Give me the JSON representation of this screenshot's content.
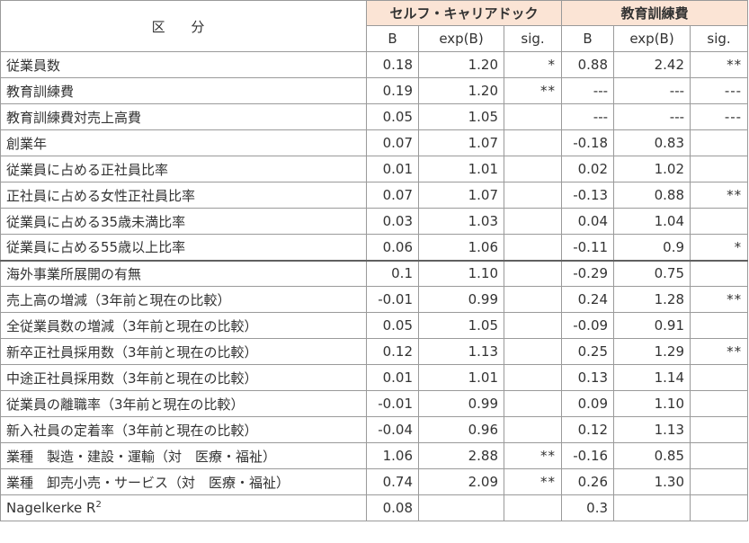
{
  "header": {
    "kubun": "区 分",
    "groups": [
      "セルフ・キャリアドック",
      "教育訓練費"
    ],
    "cols": [
      "B",
      "exp(B)",
      "sig.",
      "B",
      "exp(B)",
      "sig."
    ]
  },
  "rows": [
    {
      "label": "従業員数",
      "s_b": "0.18",
      "s_exp": "1.20",
      "s_sig": "*",
      "e_b": "0.88",
      "e_exp": "2.42",
      "e_sig": "**"
    },
    {
      "label": "教育訓練費",
      "s_b": "0.19",
      "s_exp": "1.20",
      "s_sig": "**",
      "e_b": "---",
      "e_exp": "---",
      "e_sig": "---"
    },
    {
      "label": "教育訓練費対売上高費",
      "s_b": "0.05",
      "s_exp": "1.05",
      "s_sig": "",
      "e_b": "---",
      "e_exp": "---",
      "e_sig": "---"
    },
    {
      "label": "創業年",
      "s_b": "0.07",
      "s_exp": "1.07",
      "s_sig": "",
      "e_b": "-0.18",
      "e_exp": "0.83",
      "e_sig": ""
    },
    {
      "label": "従業員に占める正社員比率",
      "s_b": "0.01",
      "s_exp": "1.01",
      "s_sig": "",
      "e_b": "0.02",
      "e_exp": "1.02",
      "e_sig": ""
    },
    {
      "label": "正社員に占める女性正社員比率",
      "s_b": "0.07",
      "s_exp": "1.07",
      "s_sig": "",
      "e_b": "-0.13",
      "e_exp": "0.88",
      "e_sig": "**"
    },
    {
      "label": "従業員に占める35歳未満比率",
      "s_b": "0.03",
      "s_exp": "1.03",
      "s_sig": "",
      "e_b": "0.04",
      "e_exp": "1.04",
      "e_sig": ""
    },
    {
      "label": "従業員に占める55歳以上比率",
      "s_b": "0.06",
      "s_exp": "1.06",
      "s_sig": "",
      "e_b": "-0.11",
      "e_exp": "0.9",
      "e_sig": "*"
    },
    {
      "label": "海外事業所展開の有無",
      "s_b": "0.1",
      "s_exp": "1.10",
      "s_sig": "",
      "e_b": "-0.29",
      "e_exp": "0.75",
      "e_sig": ""
    },
    {
      "label": "売上高の増減（3年前と現在の比較）",
      "s_b": "-0.01",
      "s_exp": "0.99",
      "s_sig": "",
      "e_b": "0.24",
      "e_exp": "1.28",
      "e_sig": "**"
    },
    {
      "label": "全従業員数の増減（3年前と現在の比較）",
      "s_b": "0.05",
      "s_exp": "1.05",
      "s_sig": "",
      "e_b": "-0.09",
      "e_exp": "0.91",
      "e_sig": ""
    },
    {
      "label": "新卒正社員採用数（3年前と現在の比較）",
      "s_b": "0.12",
      "s_exp": "1.13",
      "s_sig": "",
      "e_b": "0.25",
      "e_exp": "1.29",
      "e_sig": "**"
    },
    {
      "label": "中途正社員採用数（3年前と現在の比較）",
      "s_b": "0.01",
      "s_exp": "1.01",
      "s_sig": "",
      "e_b": "0.13",
      "e_exp": "1.14",
      "e_sig": ""
    },
    {
      "label": "従業員の離職率（3年前と現在の比較）",
      "s_b": "-0.01",
      "s_exp": "0.99",
      "s_sig": "",
      "e_b": "0.09",
      "e_exp": "1.10",
      "e_sig": ""
    },
    {
      "label": "新入社員の定着率（3年前と現在の比較）",
      "s_b": "-0.04",
      "s_exp": "0.96",
      "s_sig": "",
      "e_b": "0.12",
      "e_exp": "1.13",
      "e_sig": ""
    },
    {
      "label": "業種　製造・建設・運輸（対　医療・福祉）",
      "s_b": "1.06",
      "s_exp": "2.88",
      "s_sig": "**",
      "e_b": "-0.16",
      "e_exp": "0.85",
      "e_sig": ""
    },
    {
      "label": "業種　卸売小売・サービス（対　医療・福祉）",
      "s_b": "0.74",
      "s_exp": "2.09",
      "s_sig": "**",
      "e_b": "0.26",
      "e_exp": "1.30",
      "e_sig": ""
    }
  ],
  "r2": {
    "label": "Nagelkerke R",
    "sup": "2",
    "s_b": "0.08",
    "e_b": "0.3"
  }
}
